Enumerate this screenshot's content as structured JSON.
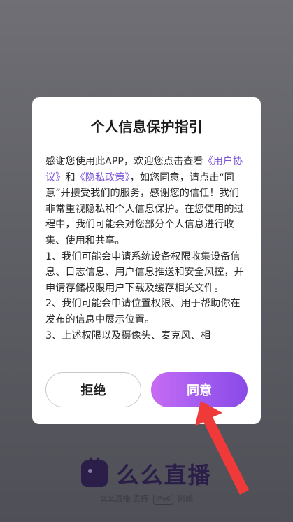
{
  "dialog": {
    "title": "个人信息保护指引",
    "body": {
      "intro_pre": "感谢您使用此APP，欢迎您点击查看",
      "user_agreement_link": "《用户协议》",
      "and": "和",
      "privacy_policy_link": "《隐私政策》",
      "intro_post": "，如您同意，请点击“同意”并接受我们的服务，感谢您的信任！我们非常重视隐私和个人信息保护。在您使用的过程中，我们可能会对您部分个人信息进行收集、使用和共享。",
      "item1": "1、我们可能会申请系统设备权限收集设备信息、日志信息、用户信息推送和安全风控，并申请存储权限用户下载及缓存相关文件。",
      "item2": "2、我们可能会申请位置权限、用于帮助你在发布的信息中展示位置。",
      "item3": "3、上述权限以及摄像头、麦克风、相"
    },
    "decline_label": "拒绝",
    "agree_label": "同意"
  },
  "brand": {
    "name": "么么直播",
    "sub_pre": "么么直播 支持",
    "ipv6": "IPv6",
    "sub_post": "网络"
  },
  "colors": {
    "link": "#7b54d6",
    "agree_gradient_start": "#c86bf3",
    "agree_gradient_end": "#8a4ae6",
    "annotation_arrow": "#f03a3a"
  },
  "icons": {
    "brand_logo": "cat-ear-logo-icon",
    "annotation": "red-arrow-icon"
  }
}
